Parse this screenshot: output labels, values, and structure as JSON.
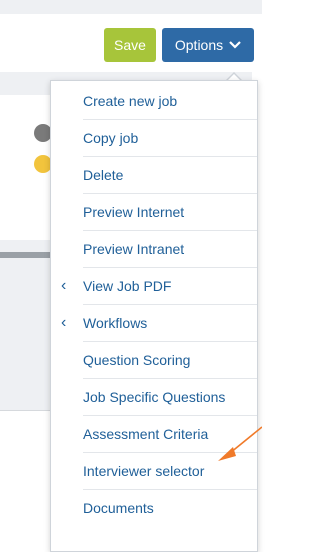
{
  "toolbar": {
    "save_label": "Save",
    "options_label": "Options",
    "options_icon": "chevron-down-icon"
  },
  "menu": {
    "items": [
      {
        "label": "Create new job"
      },
      {
        "label": "Copy job"
      },
      {
        "label": "Delete"
      },
      {
        "label": "Preview Internet"
      },
      {
        "label": "Preview Intranet"
      },
      {
        "label": "View Job PDF",
        "has_submenu": true
      },
      {
        "label": "Workflows",
        "has_submenu": true
      },
      {
        "label": "Question Scoring"
      },
      {
        "label": "Job Specific Questions"
      },
      {
        "label": "Assessment Criteria"
      },
      {
        "label": "Interviewer selector"
      },
      {
        "label": "Documents"
      }
    ],
    "submenu_icon": "chevron-left-icon"
  },
  "colors": {
    "save": "#a7c53a",
    "options": "#2e6aa6",
    "menu_text": "#1f5f98",
    "annotation_arrow": "#f07a2a"
  }
}
